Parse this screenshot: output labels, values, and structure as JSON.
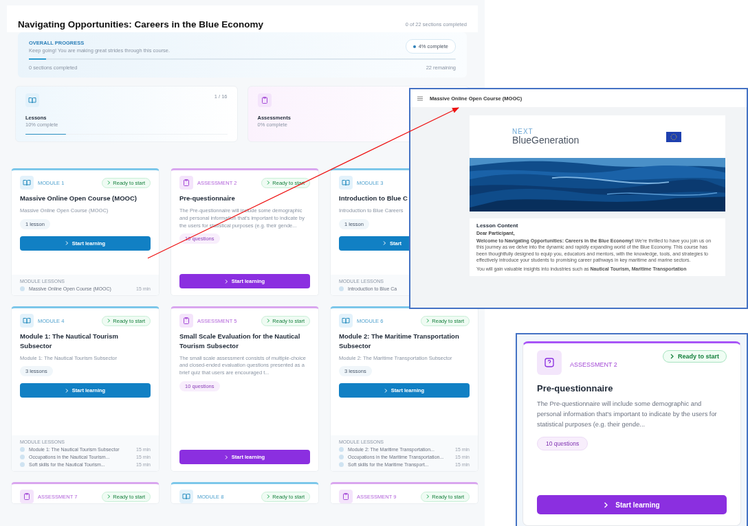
{
  "course": {
    "title": "Navigating Opportunities: Careers in the Blue Economy",
    "sections_completed": "0 of 22 sections completed"
  },
  "progress": {
    "label": "OVERALL PROGRESS",
    "message": "Keep going! You are making great strides through this course.",
    "percent": "4% complete",
    "level": 0.04,
    "completed": "0 sections completed",
    "remaining": "22 remaining"
  },
  "stats": [
    {
      "kind": "module",
      "title": "Lessons",
      "sub": "10% complete",
      "count": "1 / 16",
      "level": 0.2
    },
    {
      "kind": "assessment",
      "title": "Assessments",
      "sub": "0% complete"
    }
  ],
  "cards": [
    {
      "kind": "module",
      "label": "MODULE 1",
      "status": "Ready to start",
      "title": "Massive Online Open Course (MOOC)",
      "text": "Massive Online Open Course (MOOC)",
      "chip": "1 lesson",
      "button": "Start learning",
      "lessons_label": "MODULE LESSONS",
      "lessons": [
        {
          "title": "Massive Online Open Course (MOOC)",
          "time": "15 min"
        }
      ]
    },
    {
      "kind": "assessment",
      "label": "ASSESSMENT 2",
      "status": "Ready to start",
      "title": "Pre-questionnaire",
      "text": "The Pre-questionnaire will include some demographic and personal information that's important to indicate by the users for statistical purposes (e.g. their gende...",
      "chip": "10 questions",
      "button": "Start learning"
    },
    {
      "kind": "module",
      "label": "MODULE 3",
      "title": "Introduction to Blue C",
      "text": "Introduction to Blue Careers",
      "chip": "1 lesson",
      "button": "Start",
      "lessons_label": "MODULE LESSONS",
      "lessons": [
        {
          "title": "Introduction to Blue Ca"
        }
      ]
    },
    {
      "kind": "module",
      "label": "MODULE 4",
      "status": "Ready to start",
      "title": "Module 1: The Nautical Tourism Subsector",
      "text": "Module 1: The Nautical Tourism Subsector",
      "chip": "3 lessons",
      "button": "Start learning",
      "lessons_label": "MODULE LESSONS",
      "lessons": [
        {
          "title": "Module 1: The Nautical Tourism Subsector",
          "time": "15 min"
        },
        {
          "title": "Occupations in the Nautical Tourism...",
          "time": "15 min"
        },
        {
          "title": "Soft skills for the Nautical Tourism...",
          "time": "15 min"
        }
      ]
    },
    {
      "kind": "assessment",
      "label": "ASSESSMENT 5",
      "status": "Ready to start",
      "title": "Small Scale Evaluation for the Nautical Tourism Subsector",
      "text": "The small scale assessment consists of multiple-choice and closed-ended evaluation questions presented as a brief quiz that users are encouraged t...",
      "chip": "10 questions",
      "button": "Start learning"
    },
    {
      "kind": "module",
      "label": "MODULE 6",
      "status": "Ready to start",
      "title": "Module 2: The Maritime Transportation Subsector",
      "text": "Module 2: The Maritime Transportation Subsector",
      "chip": "3 lessons",
      "button": "Start learning",
      "lessons_label": "MODULE LESSONS",
      "lessons": [
        {
          "title": "Module 2: The Maritime Transportation...",
          "time": "15 min"
        },
        {
          "title": "Occupations in the Maritime Transportation...",
          "time": "15 min"
        },
        {
          "title": "Soft skills for the Maritime Transport...",
          "time": "15 min"
        }
      ]
    },
    {
      "kind": "assessment",
      "label": "ASSESSMENT 7",
      "status": "Ready to start"
    },
    {
      "kind": "module",
      "label": "MODULE 8",
      "status": "Ready to start"
    },
    {
      "kind": "assessment",
      "label": "ASSESSMENT 9",
      "status": "Ready to start"
    }
  ],
  "lesson_window": {
    "title": "Massive Online Open Course (MOOC)",
    "logo_top": "NEXT",
    "logo_name": "BlueGeneration",
    "heading": "Lesson Content",
    "greeting": "Dear Participant,",
    "paragraphs": [
      "**Welcome to Navigating Opportunities: Careers in the Blue Economy!** We're thrilled to have you join us on this journey as we delve into the dynamic and rapidly expanding world of the Blue Economy. This course has been thoughtfully designed to equip you, educators and mentors, with the knowledge, tools, and strategies to effectively introduce your students to promising career pathways in key maritime and marine sectors.",
      "You will gain valuable insights into industries such as **Nautical Tourism, Maritime Transportation**"
    ]
  },
  "zoomed_card": {
    "kind": "assessment",
    "label": "ASSESSMENT 2",
    "status": "Ready to start",
    "title": "Pre-questionnaire",
    "text": "The Pre-questionnaire will include some demographic and personal information that's important to indicate by the users for statistical purposes (e.g. their gende...",
    "chip": "10 questions",
    "button": "Start learning"
  }
}
